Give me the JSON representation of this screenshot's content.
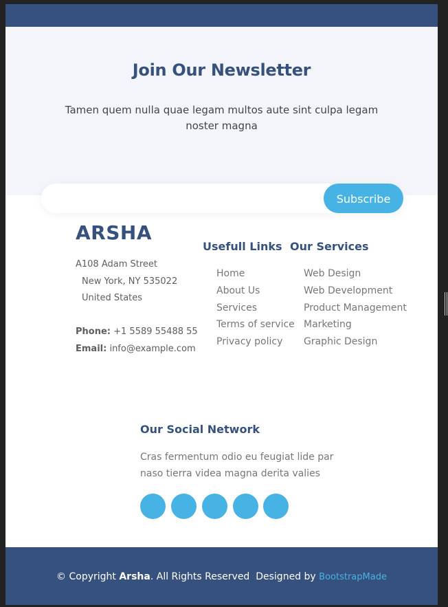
{
  "newsletter": {
    "title": "Join Our Newsletter",
    "text": "Tamen quem nulla quae legam multos aute sint culpa legam noster magna",
    "email_placeholder": "",
    "subscribe_label": "Subscribe"
  },
  "footer": {
    "brand": "ARSHA",
    "address": {
      "line1": "A108 Adam Street",
      "line2": "New York, NY 535022",
      "line3": "United States"
    },
    "phone_label": "Phone:",
    "phone": "+1 5589 55488 55",
    "email_label": "Email:",
    "email": "info@example.com",
    "useful_links": {
      "title": "Usefull Links",
      "items": [
        "Home",
        "About Us",
        "Services",
        "Terms of service",
        "Privacy policy"
      ]
    },
    "services": {
      "title": "Our Services",
      "items": [
        "Web Design",
        "Web Development",
        "Product Management",
        "Marketing",
        "Graphic Design"
      ]
    },
    "social": {
      "title": "Our Social Network",
      "text": "Cras fermentum odio eu feugiat lide par naso tierra videa magna derita valies",
      "icons": [
        "twitter-icon",
        "facebook-icon",
        "instagram-icon",
        "skype-icon",
        "linkedin-icon"
      ]
    }
  },
  "copyright": {
    "prefix": "© Copyright",
    "brand": "Arsha",
    "rights": ". All Rights Reserved",
    "designed_by": "Designed by",
    "designer": "BootstrapMade"
  },
  "colors": {
    "primary": "#37517e",
    "accent": "#47b2e4",
    "newsletter_bg": "#f3f5fa"
  }
}
